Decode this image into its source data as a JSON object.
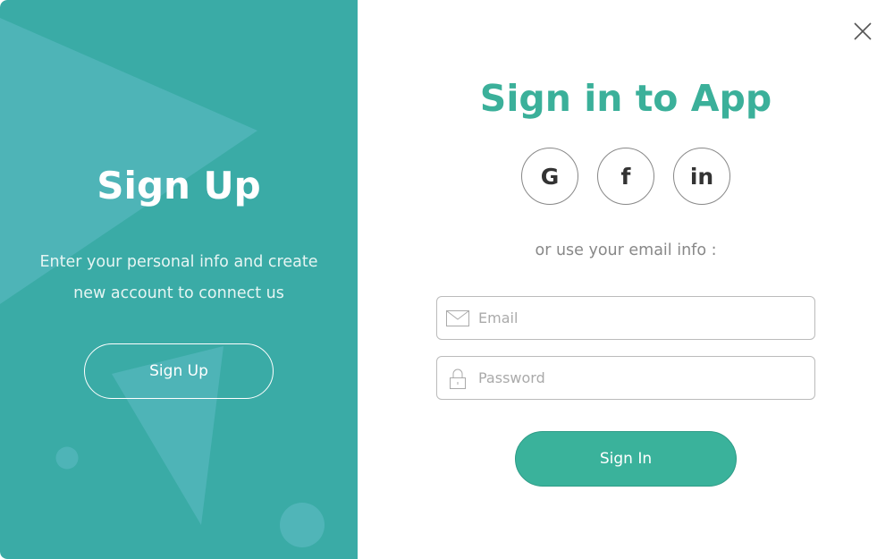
{
  "left_panel": {
    "title": "Sign Up",
    "description_line1": "Enter your personal info and create",
    "description_line2": "new account to connect us",
    "signup_button": "Sign Up",
    "bg_color": "#3aaba6"
  },
  "right_panel": {
    "title": "Sign in to App",
    "social": [
      {
        "icon": "google-icon",
        "glyph": "G"
      },
      {
        "icon": "facebook-icon",
        "glyph": "f"
      },
      {
        "icon": "linkedin-icon",
        "glyph": "in"
      }
    ],
    "divider_text": "or use your email info :",
    "email": {
      "placeholder": "Email",
      "value": ""
    },
    "password": {
      "placeholder": "Password",
      "value": ""
    },
    "signin_button": "Sign In",
    "accent_color": "#3bb09a"
  }
}
